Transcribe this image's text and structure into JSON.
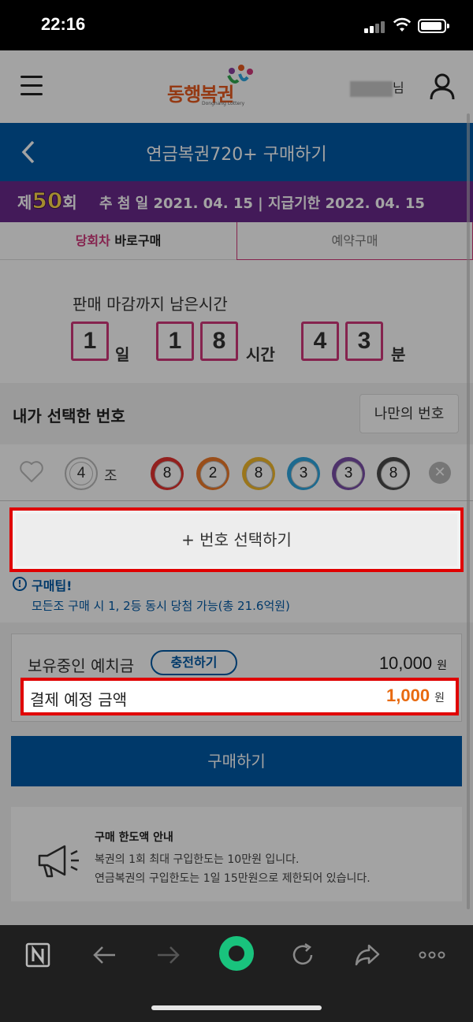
{
  "status": {
    "time": "22:16"
  },
  "header": {
    "logo_text": "동행복권",
    "logo_sub": "Donghang Lottery",
    "user_suffix": "님"
  },
  "title_bar": {
    "title": "연금복권720+ 구매하기"
  },
  "round": {
    "prefix": "제",
    "number": "50",
    "suffix": "회",
    "info": "추 첨 일 2021. 04. 15 | 지급기한 2022. 04. 15"
  },
  "tabs": [
    {
      "highlight": "당회차",
      "label": " 바로구매"
    },
    {
      "label": "예약구매"
    }
  ],
  "countdown": {
    "label": "판매 마감까지 남은시간",
    "day_digit": "1",
    "day_unit": "일",
    "hour_digit1": "1",
    "hour_digit2": "8",
    "hour_unit": "시간",
    "min_digit1": "4",
    "min_digit2": "3",
    "min_unit": "분"
  },
  "selection": {
    "title": "내가 선택한 번호",
    "my_numbers_button": "나만의 번호",
    "group": "4",
    "group_label": "조",
    "balls": [
      {
        "value": "8",
        "color": "#e4332f"
      },
      {
        "value": "2",
        "color": "#f07a2a"
      },
      {
        "value": "8",
        "color": "#f2b92b"
      },
      {
        "value": "3",
        "color": "#2ea7e0"
      },
      {
        "value": "3",
        "color": "#7a4fa8"
      },
      {
        "value": "8",
        "color": "#4a4a4a"
      }
    ],
    "clear_symbol": "✕"
  },
  "add_select": {
    "label": "+ 번호 선택하기"
  },
  "tip": {
    "icon": "!",
    "title": "구매팁!",
    "text": "모든조 구매 시 1, 2등 동시 당첨 가능(총 21.6억원)"
  },
  "deposit": {
    "label": "보유중인 예치금",
    "charge_button": "충전하기",
    "amount": "10,000",
    "unit": "원"
  },
  "payment": {
    "label": "결제 예정 금액",
    "amount": "1,000",
    "unit": "원"
  },
  "buy_button": {
    "label": "구매하기"
  },
  "limit": {
    "title": "구매 한도액 안내",
    "line1": "복권의 1회 최대 구입한도는 10만원 입니다.",
    "line2": "연금복권의 구입한도는 1일 15만원으로 제한되어 있습니다."
  },
  "colors": {
    "primary_blue": "#005aa6",
    "accent_pink": "#d1377a",
    "banner_purple": "#6a2a8c",
    "highlight_red": "#e00000",
    "amount_orange": "#e86a10"
  }
}
